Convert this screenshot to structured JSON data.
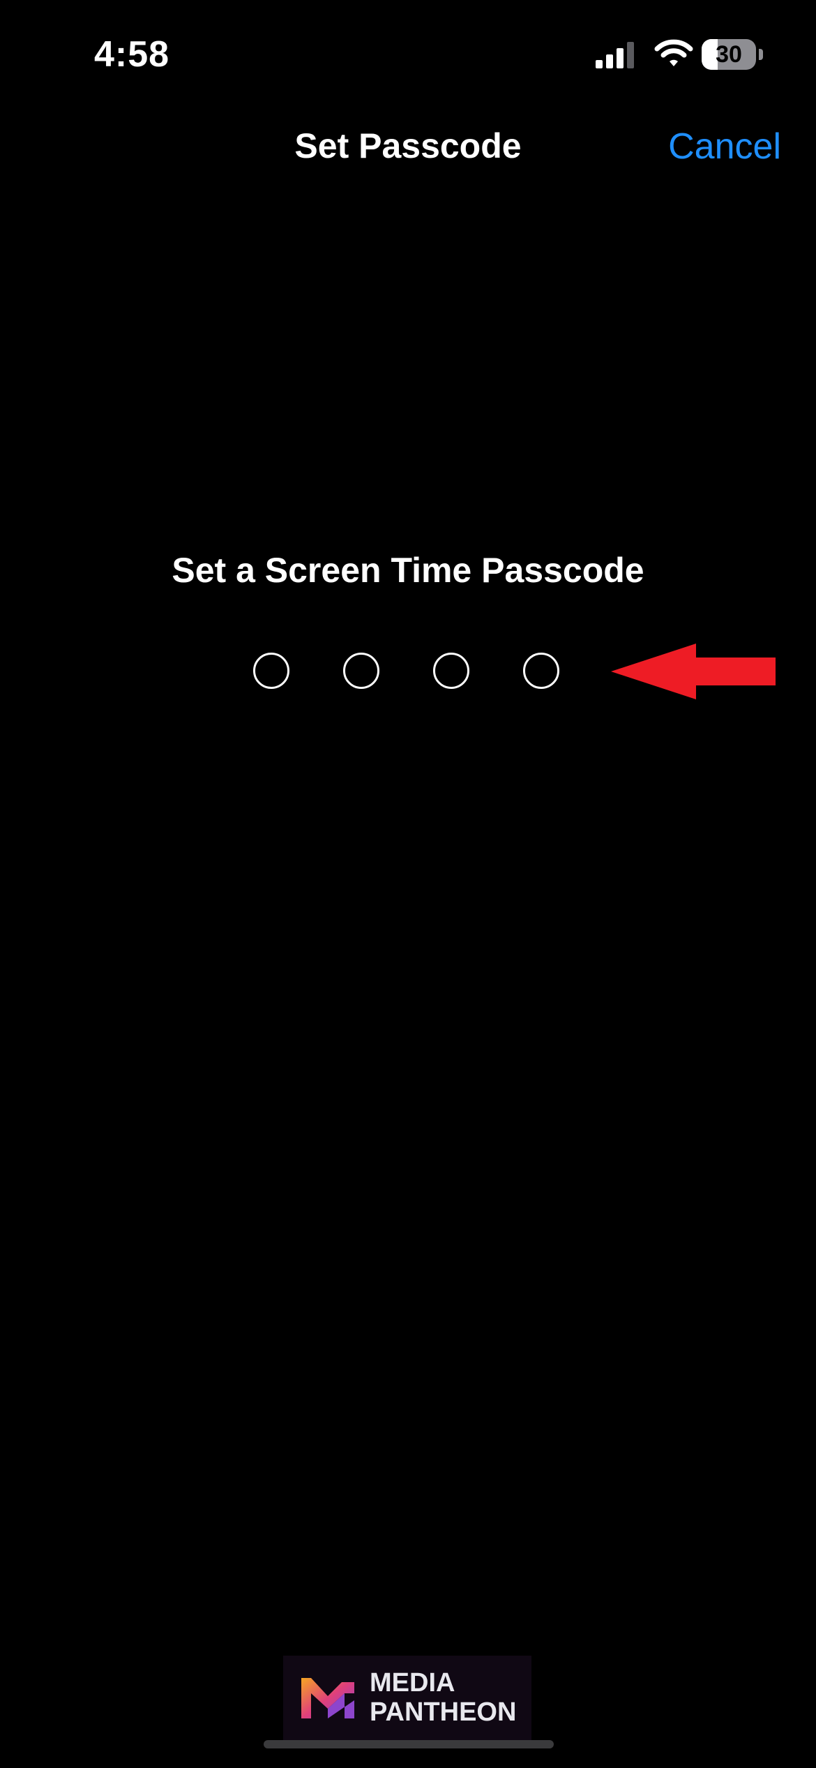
{
  "status_bar": {
    "time": "4:58",
    "battery_level": "30",
    "battery_fraction": 0.3,
    "icons": [
      "cellular-signal-icon",
      "wifi-icon",
      "battery-icon"
    ]
  },
  "nav": {
    "title": "Set Passcode",
    "cancel_label": "Cancel"
  },
  "passcode": {
    "prompt": "Set a Screen Time Passcode",
    "digits_total": 4,
    "digits_entered": 0
  },
  "annotation": {
    "icon": "red-arrow-icon",
    "color": "#ee1c25"
  },
  "watermark": {
    "line1": "MEDIA",
    "line2": "PANTHEON"
  },
  "colors": {
    "background": "#000000",
    "accent": "#1f8fff",
    "text": "#ffffff"
  }
}
